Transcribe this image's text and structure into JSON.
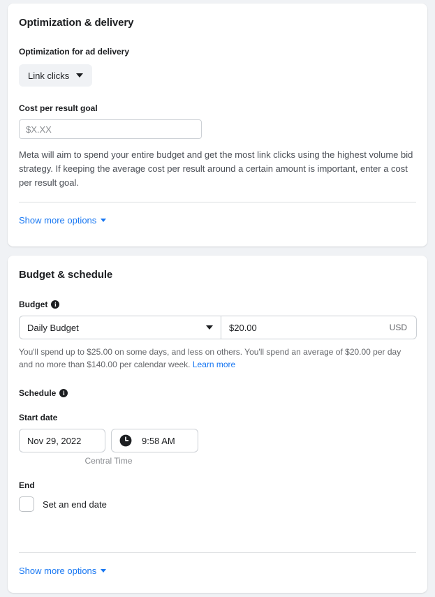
{
  "optimization_card": {
    "title": "Optimization & delivery",
    "optimization_field": {
      "label": "Optimization for ad delivery",
      "selected": "Link clicks",
      "caret_icon": "chevron-down-icon"
    },
    "cost_goal_field": {
      "label": "Cost per result goal",
      "value": "",
      "placeholder": "$X.XX"
    },
    "help_text": "Meta will aim to spend your entire budget and get the most link clicks using the highest volume bid strategy. If keeping the average cost per result around a certain amount is important, enter a cost per result goal.",
    "show_more_label": "Show more options"
  },
  "budget_card": {
    "title": "Budget & schedule",
    "budget_field": {
      "label": "Budget",
      "info_icon": "info-icon",
      "info_glyph": "i",
      "budget_type": "Daily Budget",
      "caret_icon": "chevron-down-icon",
      "amount": "$20.00",
      "currency": "USD"
    },
    "budget_note_part1": "You'll spend up to $25.00 on some days, and less on others. You'll spend an average of $20.00 per day and no more than $140.00 per calendar week. ",
    "budget_note_link": "Learn more",
    "schedule_field": {
      "label": "Schedule",
      "info_icon": "info-icon",
      "info_glyph": "i"
    },
    "start_date_field": {
      "label": "Start date",
      "date": "Nov 29, 2022",
      "time": "9:58 AM",
      "clock_icon": "clock-icon",
      "timezone_note": "Central Time"
    },
    "end_field": {
      "label": "End",
      "checkbox_checked": false,
      "checkbox_label": "Set an end date"
    },
    "show_more_label": "Show more options"
  },
  "colors": {
    "link": "#1877f2",
    "page_background": "#f0f2f5",
    "card_background": "#ffffff",
    "border": "#ccd0d5",
    "text_primary": "#1c1e21",
    "text_secondary": "#65676b"
  }
}
